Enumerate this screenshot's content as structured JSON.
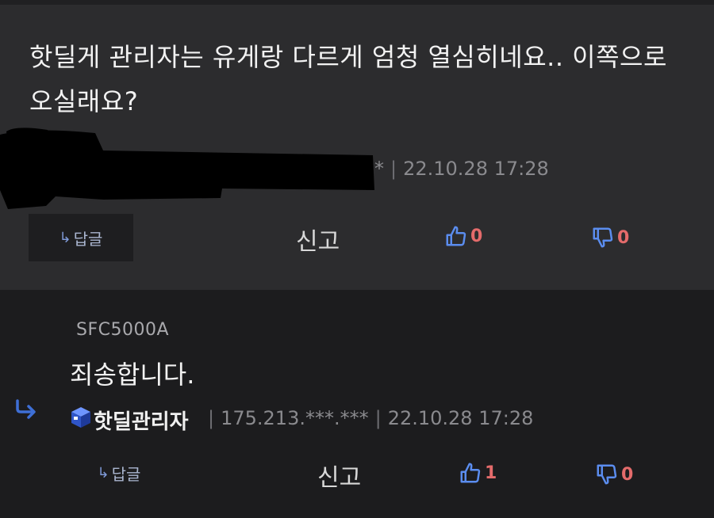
{
  "comment1": {
    "text": "핫딜게 관리자는 유게랑 다르게 엄청 열심히네요.. 이쪽으로 오실래요?",
    "author_tail": "*",
    "date": "22.10.28 17:28",
    "reply_label": "답글",
    "report_label": "신고",
    "likes": "0",
    "dislikes": "0"
  },
  "comment2": {
    "mention": "SFC5000A",
    "text": "죄송합니다.",
    "author": "핫딜관리자",
    "ip": "175.213.***.***",
    "date": "22.10.28 17:28",
    "reply_label": "답글",
    "report_label": "신고",
    "likes": "1",
    "dislikes": "0"
  },
  "colors": {
    "card_bg": "#2c2c2e",
    "page_bg": "#1c1c1e",
    "accent_blue": "#5b8def",
    "count_red": "#e46b6b"
  },
  "icons": [
    "reply-arrow-icon",
    "thumbs-up-icon",
    "thumbs-down-icon",
    "manager-cube-icon"
  ]
}
